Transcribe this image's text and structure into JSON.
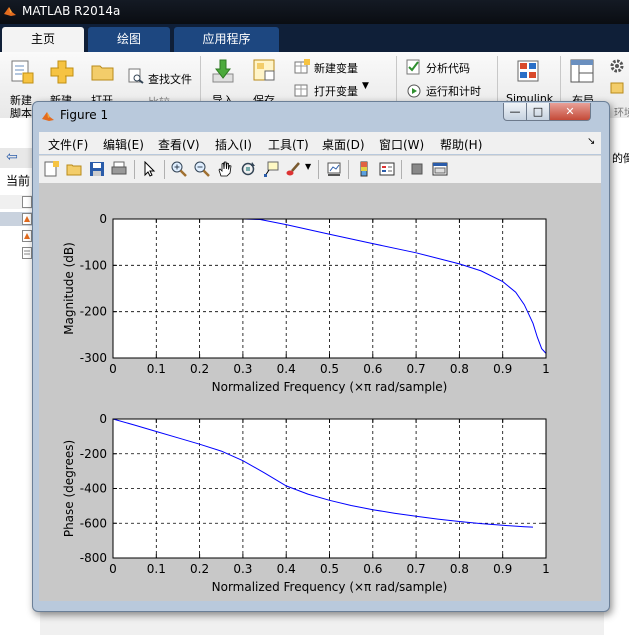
{
  "app": {
    "title": "MATLAB R2014a",
    "tabs": [
      {
        "label": "主页",
        "active": true
      },
      {
        "label": "绘图",
        "active": false
      },
      {
        "label": "应用程序",
        "active": false
      }
    ]
  },
  "ribbon": {
    "new_script": "新建\n脚本",
    "new_script_line1": "新建",
    "new_script_line2": "脚本",
    "new": "新建",
    "open": "打开",
    "find_files": "查找文件",
    "compare": "比较",
    "import": "导入",
    "save": "保存",
    "new_variable": "新建变量",
    "open_variable": "打开变量",
    "analyze_code": "分析代码",
    "run_and_time": "运行和计时",
    "simulink": "Simulink",
    "layout": "布局",
    "environment": "环境"
  },
  "side": {
    "current_folder": "当前",
    "right_text": "的倒"
  },
  "figure": {
    "title": "Figure 1",
    "menus": [
      "文件(F)",
      "编辑(E)",
      "查看(V)",
      "插入(I)",
      "工具(T)",
      "桌面(D)",
      "窗口(W)",
      "帮助(H)"
    ],
    "toolbar_icons": [
      "new-figure-icon",
      "open-file-icon",
      "save-icon",
      "print-icon",
      "pointer-icon",
      "zoom-in-icon",
      "zoom-out-icon",
      "pan-hand-icon",
      "rotate-3d-icon",
      "data-cursor-icon",
      "brush-icon",
      "link-plot-icon",
      "colorbar-icon",
      "legend-icon",
      "hide-plot-tools-icon",
      "show-plot-tools-icon"
    ]
  },
  "colors": {
    "line": "#0000ff",
    "axes_bg": "#ffffff",
    "figure_bg": "#c8c8c8"
  },
  "chart_data": [
    {
      "type": "line",
      "title": "",
      "xlabel": "Normalized Frequency  (×π rad/sample)",
      "ylabel": "Magnitude (dB)",
      "xlim": [
        0,
        1
      ],
      "ylim": [
        -300,
        0
      ],
      "xticks": [
        "0",
        "0.1",
        "0.2",
        "0.3",
        "0.4",
        "0.5",
        "0.6",
        "0.7",
        "0.8",
        "0.9",
        "1"
      ],
      "yticks": [
        "0",
        "-100",
        "-200",
        "-300"
      ],
      "grid": true,
      "series": [
        {
          "x": [
            0,
            0.1,
            0.2,
            0.3,
            0.34,
            0.4,
            0.5,
            0.6,
            0.7,
            0.8,
            0.85,
            0.9,
            0.93,
            0.95,
            0.97,
            0.98,
            0.99,
            1.0
          ],
          "y": [
            0,
            0,
            0,
            0,
            -1,
            -12,
            -33,
            -53,
            -73,
            -97,
            -112,
            -135,
            -158,
            -185,
            -225,
            -255,
            -280,
            -290
          ]
        }
      ]
    },
    {
      "type": "line",
      "title": "",
      "xlabel": "Normalized Frequency  (×π rad/sample)",
      "ylabel": "Phase (degrees)",
      "xlim": [
        0,
        1
      ],
      "ylim": [
        -800,
        0
      ],
      "xticks": [
        "0",
        "0.1",
        "0.2",
        "0.3",
        "0.4",
        "0.5",
        "0.6",
        "0.7",
        "0.8",
        "0.9",
        "1"
      ],
      "yticks": [
        "0",
        "-200",
        "-400",
        "-600",
        "-800"
      ],
      "grid": true,
      "series": [
        {
          "x": [
            0,
            0.05,
            0.1,
            0.15,
            0.2,
            0.25,
            0.3,
            0.35,
            0.4,
            0.45,
            0.5,
            0.55,
            0.6,
            0.65,
            0.7,
            0.75,
            0.8,
            0.85,
            0.9,
            0.95,
            0.97
          ],
          "y": [
            0,
            -35,
            -72,
            -108,
            -145,
            -185,
            -240,
            -310,
            -385,
            -432,
            -468,
            -498,
            -522,
            -542,
            -560,
            -576,
            -590,
            -602,
            -612,
            -620,
            -622
          ]
        }
      ]
    }
  ]
}
